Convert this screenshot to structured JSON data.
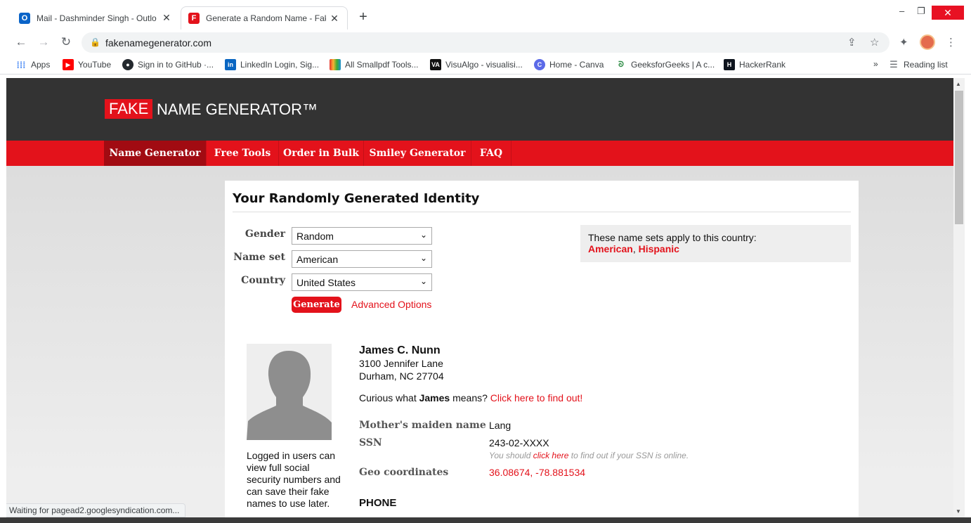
{
  "tabs": [
    {
      "title": "Mail - Dashminder Singh - Outlo",
      "icon": "outlook-icon",
      "color": "#0a64c8"
    },
    {
      "title": "Generate a Random Name - Fake",
      "icon": "fake-name-generator-icon",
      "color": "#e3121b"
    }
  ],
  "window": {
    "minimize": "–",
    "restore": "❐",
    "close": "✕"
  },
  "address": {
    "url": "fakenamegenerator.com"
  },
  "bookmarks": [
    {
      "label": "Apps",
      "icon": "apps-grid-icon"
    },
    {
      "label": "YouTube",
      "icon": "youtube-icon",
      "color": "#ff0000"
    },
    {
      "label": "Sign in to GitHub ·...",
      "icon": "github-icon",
      "color": "#24292e"
    },
    {
      "label": "LinkedIn Login, Sig...",
      "icon": "linkedin-icon",
      "color": "#0a66c2"
    },
    {
      "label": "All Smallpdf Tools...",
      "icon": "smallpdf-icon",
      "color": "#e5322d"
    },
    {
      "label": "VisuAlgo - visualisi...",
      "icon": "visualgo-icon",
      "color": "#111111"
    },
    {
      "label": "Home - Canva",
      "icon": "canva-icon",
      "color": "#5b6ae8"
    },
    {
      "label": "GeeksforGeeks | A c...",
      "icon": "geeksforgeeks-icon",
      "color": "#2f8d46"
    },
    {
      "label": "HackerRank",
      "icon": "hackerrank-icon",
      "color": "#0e141e"
    }
  ],
  "reading_list": "Reading list",
  "more_bookmarks": "»",
  "site": {
    "logo_fake": "FAKE",
    "logo_rest": "NAME GENERATOR™",
    "nav": [
      "Name Generator",
      "Free Tools",
      "Order in Bulk",
      "Smiley Generator",
      "FAQ"
    ]
  },
  "form": {
    "title": "Your Randomly Generated Identity",
    "gender_label": "Gender",
    "gender_value": "Random",
    "nameset_label": "Name set",
    "nameset_value": "American",
    "country_label": "Country",
    "country_value": "United States",
    "generate": "Generate",
    "advanced": "Advanced Options"
  },
  "name_sets": {
    "intro": "These name sets apply to this country:",
    "set1": "American",
    "sep": ",",
    "set2": "Hispanic"
  },
  "identity": {
    "name": "James C. Nunn",
    "street": "3100 Jennifer Lane",
    "city": "Durham, NC 27704",
    "curious_pre": "Curious what",
    "first_name": "James",
    "curious_mid": "means?",
    "curious_link": "Click here to find out!",
    "logged_in_note": "Logged in users can view full social security numbers and can save their fake names to use later.",
    "maiden_label": "Mother's maiden name",
    "maiden_value": "Lang",
    "ssn_label": "SSN",
    "ssn_value": "243-02-XXXX",
    "ssn_note_pre": "You should",
    "ssn_note_link": "click here",
    "ssn_note_post": "to find out if your SSN is online.",
    "geo_label": "Geo coordinates",
    "geo_value": "36.08674, -78.881534",
    "phone_heading": "PHONE"
  },
  "status": "Waiting for pagead2.googlesyndication.com..."
}
